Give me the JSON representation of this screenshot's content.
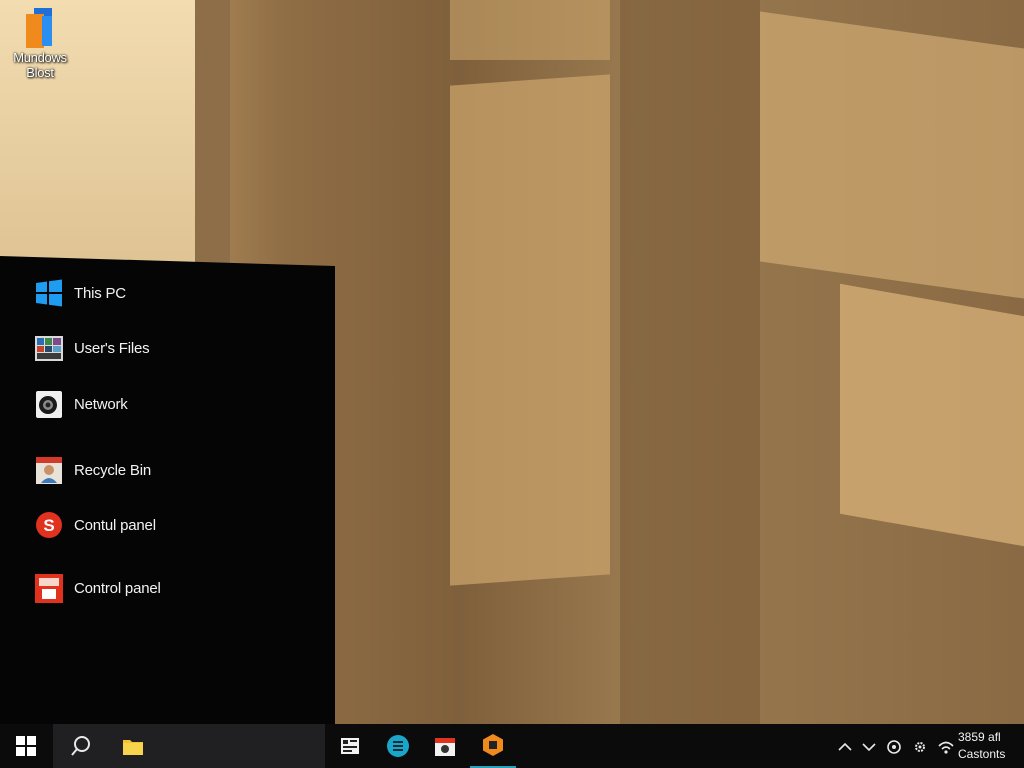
{
  "desktop": {
    "icon_label": "Mundows\nBlost"
  },
  "start_menu": {
    "items": [
      {
        "label": "This PC",
        "icon": "windows-logo-icon"
      },
      {
        "label": "User's Files",
        "icon": "photo-collage-icon"
      },
      {
        "label": "Network",
        "icon": "camera-lens-icon"
      },
      {
        "label": "Recycle Bin",
        "icon": "portrait-icon"
      },
      {
        "label": "Contul panel",
        "icon": "red-badge-icon"
      },
      {
        "label": "Control panel",
        "icon": "red-app-icon"
      }
    ]
  },
  "taskbar": {
    "pinned": [
      {
        "icon": "tile-app-icon"
      },
      {
        "icon": "teal-circle-app-icon"
      },
      {
        "icon": "calendar-app-icon"
      },
      {
        "icon": "orange-hexagon-app-icon"
      }
    ],
    "tray": [
      {
        "icon": "chevron-up-icon"
      },
      {
        "icon": "chevron-down-icon"
      },
      {
        "icon": "circle-settings-icon"
      },
      {
        "icon": "gear-icon"
      },
      {
        "icon": "wifi-icon"
      }
    ],
    "clock_line1": "3859 afl",
    "clock_line2": "Castonts"
  },
  "colors": {
    "menu_bg": "#050506",
    "taskbar_bg": "#0b0b0c",
    "search_bg": "#202022",
    "accent_blue": "#1f9cf0",
    "accent_red": "#e0321e",
    "accent_orange": "#f08a1c"
  }
}
